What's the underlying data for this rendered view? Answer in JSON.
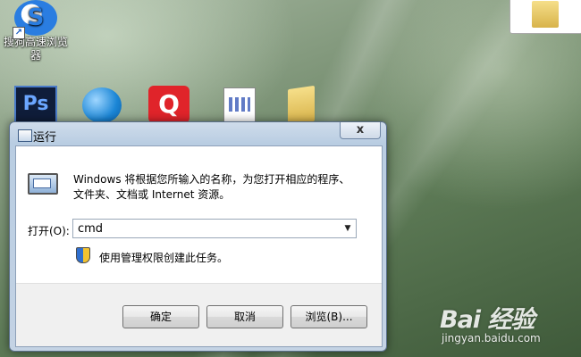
{
  "desktop": {
    "sogou_label_line1": "搜狗高速浏览",
    "sogou_label_line2": "器",
    "ps_icon_text": "Ps",
    "q_icon_text": "Q"
  },
  "dialog": {
    "title": "运行",
    "close_glyph": "x",
    "description_line1": "Windows 将根据您所输入的名称，为您打开相应的程序、",
    "description_line2": "文件夹、文档或 Internet 资源。",
    "open_label": "打开(O):",
    "open_value": "cmd",
    "admin_text": "使用管理权限创建此任务。",
    "ok_label": "确定",
    "cancel_label": "取消",
    "browse_label": "浏览(B)..."
  },
  "watermark": {
    "brand": "Bai 经验",
    "url": "jingyan.baidu.com"
  }
}
